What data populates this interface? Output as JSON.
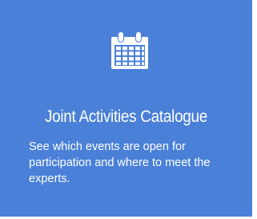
{
  "card": {
    "icon": "calendar-icon",
    "title": "Joint Activities Catalogue",
    "description": "See which events are open for participation and where to meet the experts.",
    "background_color": "#4a80d8",
    "text_color": "#ffffff"
  }
}
